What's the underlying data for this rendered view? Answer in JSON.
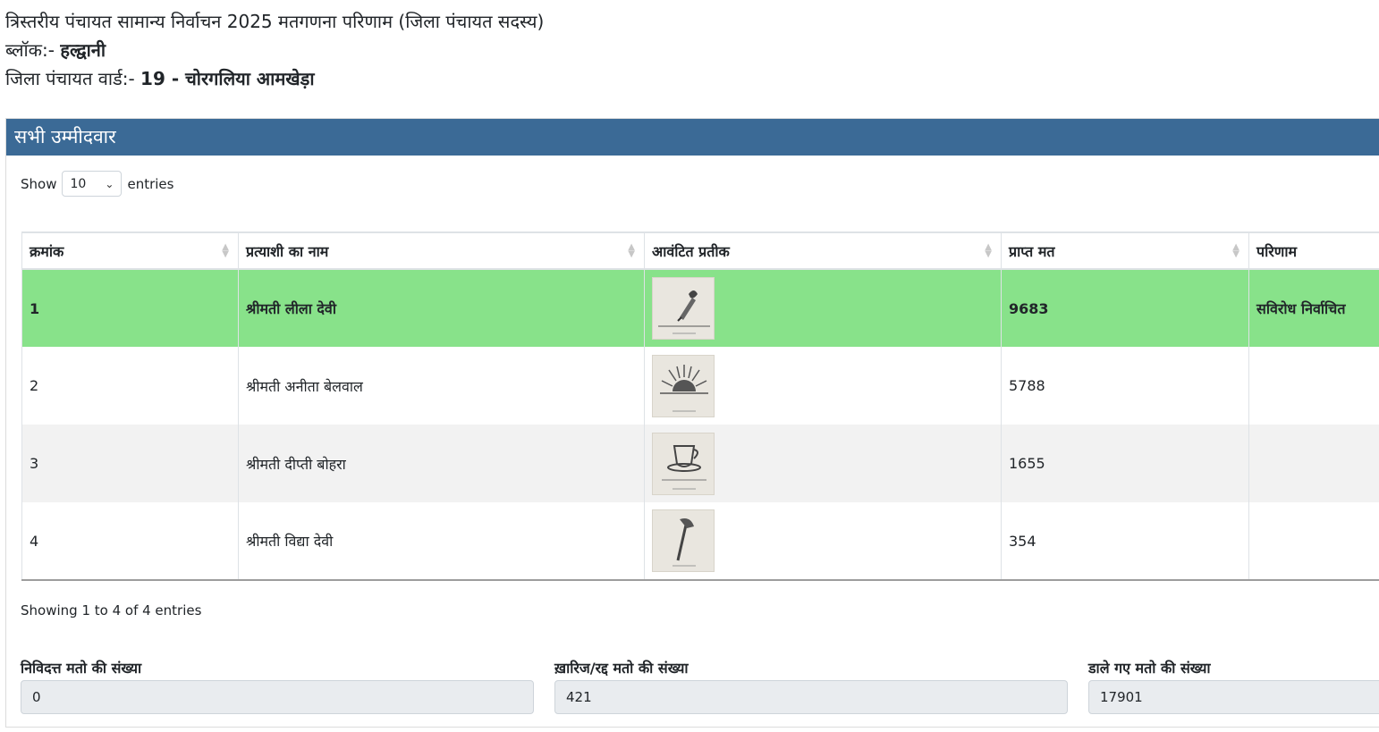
{
  "header": {
    "title": "त्रिस्तरीय पंचायत सामान्य निर्वाचन 2025 मतगणना परिणाम (जिला पंचायत सदस्य)",
    "block_label": "ब्लॉक:-",
    "block_value": "हल्द्वानी",
    "ward_label": "जिला पंचायत वार्ड:-",
    "ward_value": "19 - चोरगलिया आमखेड़ा"
  },
  "panel": {
    "title": "सभी उम्मीदवार",
    "show_label": "Show",
    "entries_value": "10",
    "entries_label": "entries",
    "showing_text": "Showing 1 to 4 of 4 entries"
  },
  "table": {
    "columns": [
      "क्रमांक",
      "प्रत्याशी का नाम",
      "आवंटित प्रतीक",
      "प्राप्त मत",
      "परिणाम"
    ],
    "rows": [
      {
        "serial": "1",
        "name": "श्रीमती लीला देवी",
        "symbol": "pen-nib-icon",
        "votes": "9683",
        "result": "सविरोध निर्वाचित"
      },
      {
        "serial": "2",
        "name": "श्रीमती अनीता बेलवाल",
        "symbol": "rising-sun-icon",
        "votes": "5788",
        "result": ""
      },
      {
        "serial": "3",
        "name": "श्रीमती दीप्ती बोहरा",
        "symbol": "cup-saucer-icon",
        "votes": "1655",
        "result": ""
      },
      {
        "serial": "4",
        "name": "श्रीमती विद्या देवी",
        "symbol": "axe-icon",
        "votes": "354",
        "result": ""
      }
    ]
  },
  "summary": {
    "disputed_label": "निविदत्त मतो की संख्या",
    "disputed_value": "0",
    "rejected_label": "ख़ारिज/रद्द मतो की संख्या",
    "rejected_value": "421",
    "cast_label": "डाले गए मतो की संख्या",
    "cast_value": "17901"
  },
  "colors": {
    "panel_header": "#3b6a96",
    "winner_row": "#88e28a",
    "input_bg": "#e9ecef"
  }
}
